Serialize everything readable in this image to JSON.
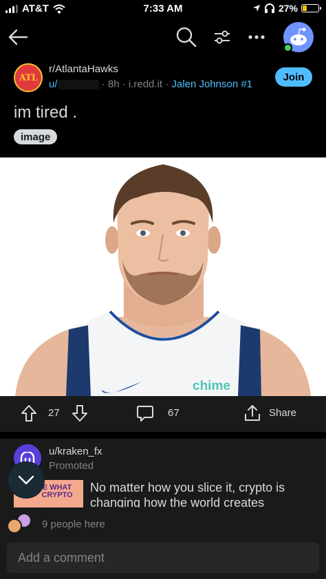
{
  "status_bar": {
    "carrier": "AT&T",
    "time": "7:33 AM",
    "battery": "27%",
    "battery_level": 0.27
  },
  "nav": {
    "icons": [
      "back-arrow-icon",
      "search-icon",
      "filter-icon",
      "more-icon",
      "avatar"
    ]
  },
  "post": {
    "subreddit": "r/AtlantaHawks",
    "subreddit_icon_text": "ATL",
    "user_prefix": "u/",
    "age": "· 8h ·",
    "domain": "i.redd.it",
    "separator": "·",
    "flair": "Jalen Johnson #1",
    "join_label": "Join",
    "title": "im tired .",
    "tag": "image",
    "jersey_text": "chime",
    "votes": "27",
    "comments": "67",
    "share_label": "Share"
  },
  "promo": {
    "user": "u/kraken_fx",
    "label": "Promoted",
    "thumb_text": "E WHAT CRYPTO",
    "text": "No matter how you slice it, crypto is changing how the world creates"
  },
  "presence": {
    "text": "9 people here"
  },
  "comment_box": {
    "placeholder": "Add a comment"
  },
  "colors": {
    "background": "#000000",
    "surface": "#1a1a1b",
    "accent": "#4fbcff",
    "muted": "#818384",
    "hawks_red": "#e03a3e"
  }
}
